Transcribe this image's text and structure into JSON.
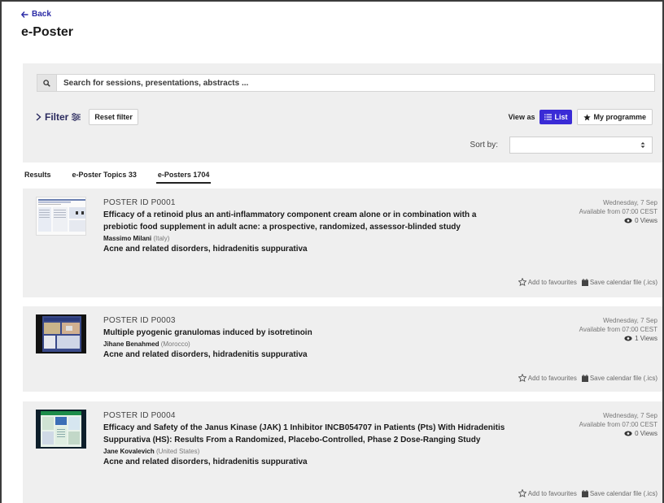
{
  "nav": {
    "back_label": "Back"
  },
  "page": {
    "title": "e-Poster"
  },
  "search": {
    "placeholder": "Search for sessions, presentations, abstracts ..."
  },
  "filter": {
    "label": "Filter",
    "reset_label": "Reset filter"
  },
  "view": {
    "label": "View as",
    "list_label": "List",
    "programme_label": "My programme",
    "active": "List"
  },
  "sort": {
    "label": "Sort by:",
    "value": ""
  },
  "tabs": [
    {
      "label": "Results"
    },
    {
      "label": "e-Poster Topics 33"
    },
    {
      "label": "e-Posters 1704",
      "active": true
    }
  ],
  "posters": [
    {
      "id_label": "POSTER ID P0001",
      "title": "Efficacy of a retinoid plus an anti-inflammatory component cream alone or in combination with a prebiotic food supplement in adult acne: a prospective, randomized, assessor-blinded study",
      "author": "Massimo Milani",
      "country": "(Italy)",
      "topic": "Acne and related disorders, hidradenitis suppurativa",
      "date": "Wednesday, 7 Sep",
      "availability": "Available from 07:00 CEST",
      "views": "0 Views",
      "fav_label": "Add to favourites",
      "cal_label": "Save calendar file (.ics)"
    },
    {
      "id_label": "POSTER ID P0003",
      "title": "Multiple pyogenic granulomas induced by isotretinoin",
      "author": "Jihane Benahmed",
      "country": "(Morocco)",
      "topic": "Acne and related disorders, hidradenitis suppurativa",
      "date": "Wednesday, 7 Sep",
      "availability": "Available from 07:00 CEST",
      "views": "1 Views",
      "fav_label": "Add to favourites",
      "cal_label": "Save calendar file (.ics)"
    },
    {
      "id_label": "POSTER ID P0004",
      "title": "Efficacy and Safety of the Janus Kinase (JAK) 1 Inhibitor INCB054707 in Patients (Pts) With Hidradenitis Suppurativa (HS): Results From a Randomized, Placebo-Controlled, Phase 2 Dose-Ranging Study",
      "author": "Jane Kovalevich",
      "country": "(United States)",
      "topic": "Acne and related disorders, hidradenitis suppurativa",
      "date": "Wednesday, 7 Sep",
      "availability": "Available from 07:00 CEST",
      "views": "0 Views",
      "fav_label": "Add to favourites",
      "cal_label": "Save calendar file (.ics)"
    }
  ],
  "colors": {
    "accent": "#3a2bd6",
    "link": "#2a2aa6",
    "panel": "#efefef"
  }
}
